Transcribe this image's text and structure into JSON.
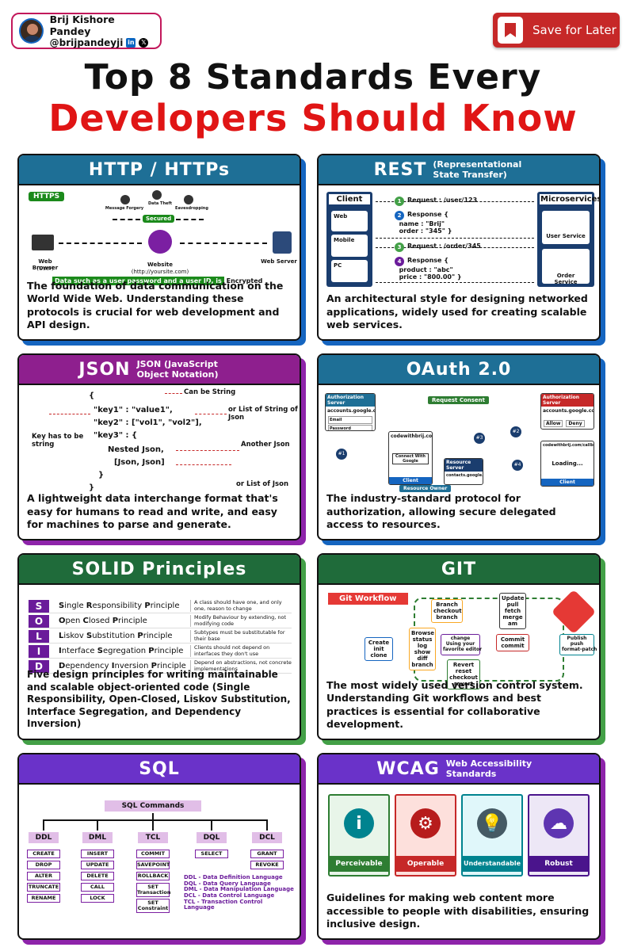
{
  "author": {
    "name": "Brij Kishore Pandey",
    "handle": "@brijpandeyji"
  },
  "save_button": {
    "label": "Save for Later"
  },
  "title": {
    "line1": "Top 8 Standards Every",
    "line2": "Developers Should Know"
  },
  "cards": {
    "http": {
      "title": "HTTP / HTTPs",
      "tag": "HTTPS",
      "threats": [
        "Message Forgery",
        "Data Theft",
        "Eavesdropping"
      ],
      "secured": "Secured",
      "browser": "Web Browser",
      "browser_sub": "(User)",
      "website": "Website",
      "website_sub": "(http://yoursite.com)",
      "server": "Web Server",
      "encrypted_note": "Data such as a user password and a user ID, is",
      "encrypted_word": "Encrypted",
      "desc": "The foundation of data communication on the World Wide Web. Understanding these protocols is crucial for web development and API design."
    },
    "rest": {
      "title": "REST",
      "subtitle": "(Representational State Transfer)",
      "client": "Client",
      "clients": [
        "Web",
        "Mobile",
        "PC"
      ],
      "microservices": "Microservices",
      "services": [
        "User Service",
        "Order Service"
      ],
      "steps": [
        {
          "n": "1",
          "text": "Request : /user/123"
        },
        {
          "n": "2",
          "text": "Response {\n  name : \"Brij\"\n  order : \"345\" }"
        },
        {
          "n": "3",
          "text": "Request : /order/345"
        },
        {
          "n": "4",
          "text": "Response {\n  product : \"abc\"\n  price : \"800.00\" }"
        }
      ],
      "desc": "An architectural style for designing networked applications, widely used for creating scalable web services."
    },
    "json": {
      "title": "JSON",
      "subtitle": "JSON (JavaScript Object Notation)",
      "lines": [
        "{",
        "\"key1\" : \"value1\",",
        "\"key2\" : [\"vol1\", \"vol2\"],",
        "\"key3\" : {",
        "Nested Json,",
        "[Json, Json]",
        "}",
        "}"
      ],
      "notes": [
        "Can be String",
        "or List of String of Json",
        "Key has to be string",
        "Another Json",
        "or List of Json"
      ],
      "desc": "A lightweight data interchange format that's easy for humans to read and write, and easy for machines to parse and generate."
    },
    "oauth": {
      "title": "OAuth 2.0",
      "auth_server": "Authorization Server",
      "auth_url": "accounts.google.com",
      "request_consent": "Request Consent",
      "site": "codewithbrij.com",
      "connect": "Connect With Google",
      "client": "Client",
      "resource_owner": "Resource Owner",
      "resource_server": "Resource Server",
      "contacts": "contacts.google.com",
      "callback": "codewithbrij.com/callback",
      "loading": "Loading...",
      "allow": "Allow",
      "deny": "Deny",
      "email": "Email",
      "password": "Password",
      "nums": [
        "#1",
        "#2",
        "#3",
        "#4"
      ],
      "desc": "The industry-standard protocol for authorization, allowing secure delegated access to resources."
    },
    "solid": {
      "title": "SOLID Principles",
      "rows": [
        {
          "letter": "S",
          "initial": "S",
          "rest1": "ingle ",
          "bold2": "R",
          "rest2": "esponsibility ",
          "bold3": "P",
          "rest3": "rinciple",
          "note": "A class should have one, and only one, reason to change"
        },
        {
          "letter": "O",
          "initial": "O",
          "rest1": "pen ",
          "bold2": "C",
          "rest2": "losed ",
          "bold3": "P",
          "rest3": "rinciple",
          "note": "Modify Behaviour by extending, not modifying code"
        },
        {
          "letter": "L",
          "initial": "L",
          "rest1": "iskov ",
          "bold2": "S",
          "rest2": "ubstitution ",
          "bold3": "P",
          "rest3": "rinciple",
          "note": "Subtypes must be substitutable for their base"
        },
        {
          "letter": "I",
          "initial": "I",
          "rest1": "nterface ",
          "bold2": "S",
          "rest2": "egregation ",
          "bold3": "P",
          "rest3": "rinciple",
          "note": "Clients should not depend on interfaces they don't use"
        },
        {
          "letter": "D",
          "initial": "D",
          "rest1": "ependency ",
          "bold2": "I",
          "rest2": "nversion ",
          "bold3": "P",
          "rest3": "rinciple",
          "note": "Depend on abstractions, not concrete implementations"
        }
      ],
      "desc": "Five design principles for writing maintainable and scalable object-oriented code (Single Responsibility, Open-Closed, Liskov Substitution, Interface Segregation, and Dependency Inversion)"
    },
    "git": {
      "title": "GIT",
      "workflow": "Git Workflow",
      "create": "Create\ninit\nclone",
      "browse": "Browse\nstatus\nlog\nshow\ndiff\nbranch",
      "branch": "Branch\ncheckout\nbranch",
      "change": "change\nUsing your\nfavorite editor",
      "revert": "Revert\nreset\ncheckout\nrevert",
      "update": "Update\npull\nfetch\nmerge\nam",
      "commit": "Commit\ncommit",
      "publish": "Publish\npush\nformat-patch",
      "desc": "The most widely used version control system. Understanding Git workflows and best practices is essential for collaborative development."
    },
    "sql": {
      "title": "SQL",
      "head": "SQL Commands",
      "categories": [
        {
          "name": "DDL",
          "cmds": [
            "CREATE",
            "DROP",
            "ALTER",
            "TRUNCATE",
            "RENAME"
          ]
        },
        {
          "name": "DML",
          "cmds": [
            "INSERT",
            "UPDATE",
            "DELETE",
            "CALL",
            "LOCK"
          ]
        },
        {
          "name": "TCL",
          "cmds": [
            "COMMIT",
            "SAVEPOINT",
            "ROLLBACK",
            "SET Transaction",
            "SET Constraint"
          ]
        },
        {
          "name": "DQL",
          "cmds": [
            "SELECT"
          ]
        },
        {
          "name": "DCL",
          "cmds": [
            "GRANT",
            "REVOKE"
          ]
        }
      ],
      "legend": [
        "DDL - Data Definition Language",
        "DQL - Data Query Language",
        "DML - Data Manipulation Language",
        "DCL - Data Control Language",
        "TCL - Transaction Control Language"
      ]
    },
    "wcag": {
      "title": "WCAG",
      "subtitle": "Web Accessibility Standards",
      "tiles": [
        "Perceivable",
        "Operable",
        "Understandable",
        "Robust"
      ],
      "desc": "Guidelines for making web content more accessible to people with disabilities, ensuring inclusive design."
    }
  },
  "colors": {
    "http": "#1e6f96",
    "rest": "#1e6f96",
    "json": "#8e1f8e",
    "oauth": "#1e6f96",
    "solid": "#1f6b3a",
    "git": "#1f6b3a",
    "sql": "#6a32c9",
    "wcag": "#6a32c9",
    "shadow_blue": "#1565c0",
    "shadow_purple": "#8e24aa",
    "shadow_green": "#43a047"
  }
}
